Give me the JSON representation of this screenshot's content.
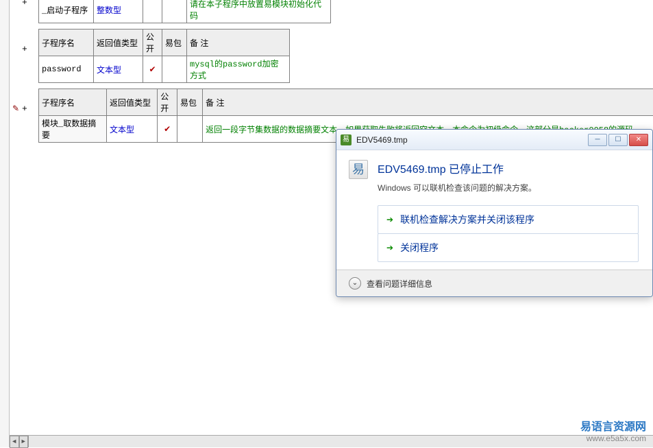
{
  "headers": {
    "proc_name": "子程序名",
    "ret_type": "返回值类型",
    "public": "公开",
    "ezpkg": "易包",
    "comment": "备 注"
  },
  "rows": [
    {
      "name": "_启动子程序",
      "ret_type": "整数型",
      "public_check": "",
      "comment": "请在本子程序中放置易模块初始化代码"
    },
    {
      "name": "password",
      "ret_type": "文本型",
      "public_check": "✔",
      "comment": "mysql的password加密方式"
    },
    {
      "name": "模块_取数据摘要",
      "ret_type": "文本型",
      "public_check": "✔",
      "comment": "返回一段字节集数据的数据摘要文本，如果获取失败将返回空文本，本命令为初级命令。这部分是hacker0058的源码"
    }
  ],
  "expand": "+",
  "edit_marker": "✎",
  "dialog": {
    "title": "EDV5469.tmp",
    "heading": "EDV5469.tmp 已停止工作",
    "subtext": "Windows 可以联机检查该问题的解决方案。",
    "opt1": "联机检查解决方案并关闭该程序",
    "opt2": "关闭程序",
    "details": "查看问题详细信息"
  },
  "watermark": {
    "cn": "易语言资源网",
    "url": "www.e5a5x.com"
  }
}
